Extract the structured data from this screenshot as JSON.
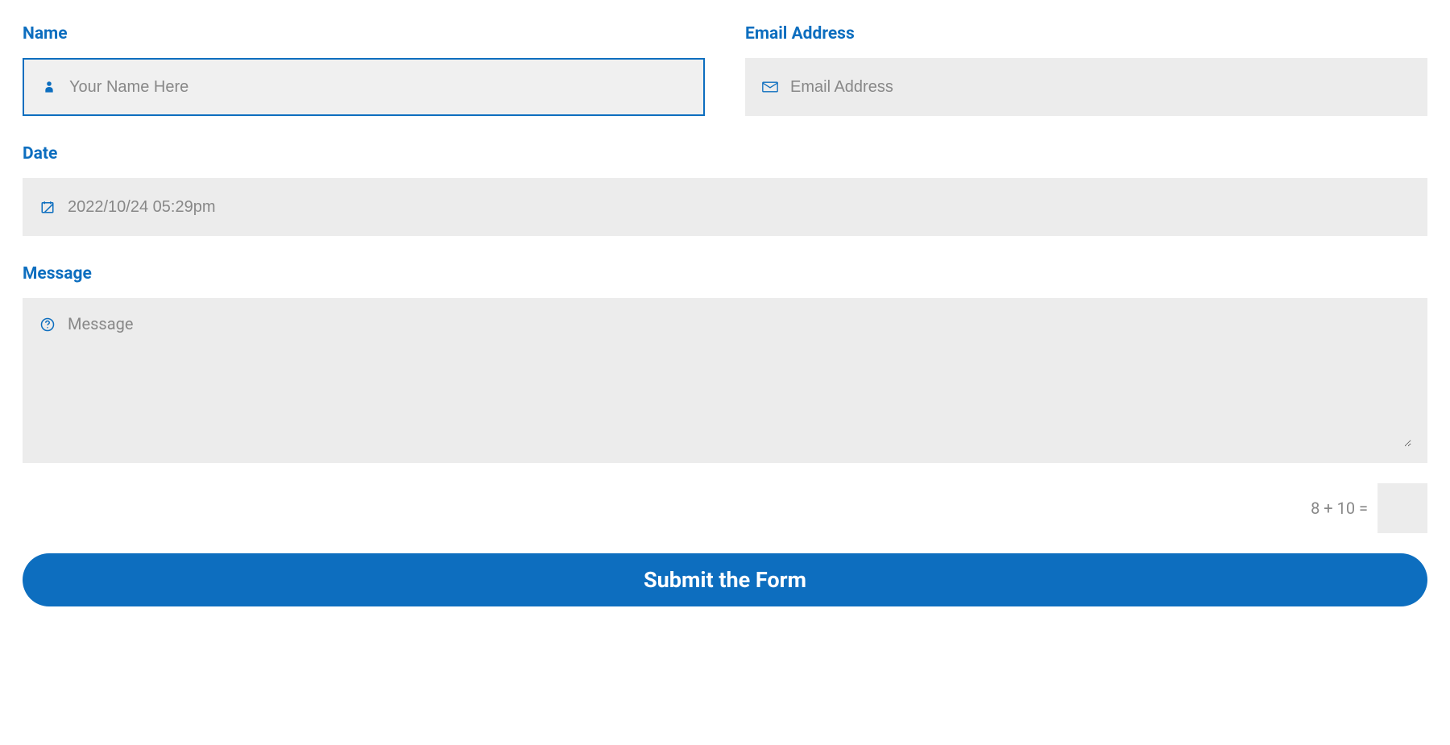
{
  "form": {
    "name": {
      "label": "Name",
      "placeholder": "Your Name Here",
      "value": ""
    },
    "email": {
      "label": "Email Address",
      "placeholder": "Email Address",
      "value": ""
    },
    "date": {
      "label": "Date",
      "placeholder": "2022/10/24 05:29pm",
      "value": ""
    },
    "message": {
      "label": "Message",
      "placeholder": "Message",
      "value": ""
    },
    "captcha": {
      "question": "8 + 10 =",
      "value": ""
    },
    "submit": {
      "label": "Submit the Form"
    }
  },
  "colors": {
    "accent": "#0d6ebf",
    "inputBg": "#ececec",
    "placeholder": "#888888"
  }
}
